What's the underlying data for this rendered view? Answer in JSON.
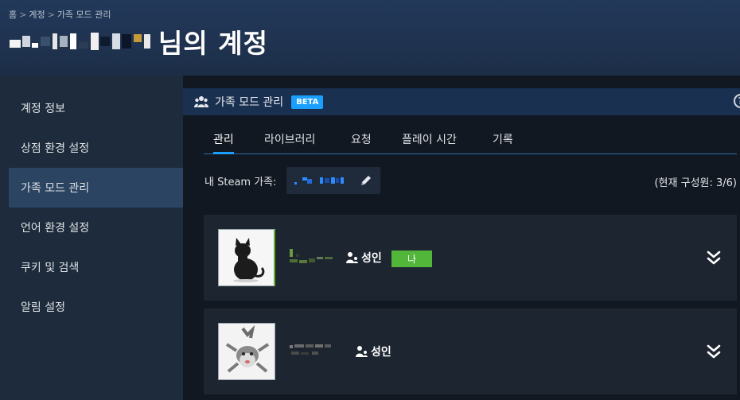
{
  "breadcrumb": {
    "home": "홈",
    "account": "계정",
    "current": "가족 모드 관리",
    "separator": ">"
  },
  "page": {
    "title_suffix": "님의 계정"
  },
  "sidebar": {
    "items": [
      {
        "label": "계정 정보"
      },
      {
        "label": "상점 환경 설정"
      },
      {
        "label": "가족 모드 관리"
      },
      {
        "label": "언어 환경 설정"
      },
      {
        "label": "쿠키 및 검색"
      },
      {
        "label": "알림 설정"
      }
    ]
  },
  "panel": {
    "title": "가족 모드 관리",
    "badge": "BETA",
    "help": "?"
  },
  "tabs": [
    {
      "label": "관리"
    },
    {
      "label": "라이브러리"
    },
    {
      "label": "요청"
    },
    {
      "label": "플레이 시간"
    },
    {
      "label": "기록"
    }
  ],
  "family": {
    "label": "내 Steam 가족:",
    "members_count": "(현재 구성원: 3/6)"
  },
  "members": [
    {
      "role": "성인",
      "badge": "나"
    },
    {
      "role": "성인"
    }
  ],
  "colors": {
    "accent": "#1a9fff",
    "me_badge": "#52b63a",
    "active_sidebar": "#2a4462"
  }
}
